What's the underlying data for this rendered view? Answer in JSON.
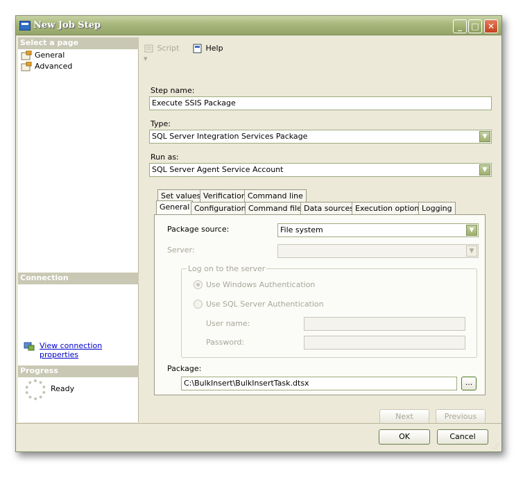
{
  "window": {
    "title": "New Job Step"
  },
  "left": {
    "select_page_header": "Select a page",
    "pages": [
      {
        "label": "General"
      },
      {
        "label": "Advanced"
      }
    ],
    "connection_header": "Connection",
    "view_connection_properties": "View connection properties",
    "progress_header": "Progress",
    "progress_status": "Ready"
  },
  "toolbar": {
    "script_label": "Script",
    "help_label": "Help"
  },
  "form": {
    "step_name_label": "Step name:",
    "step_name_value": "Execute SSIS Package",
    "type_label": "Type:",
    "type_value": "SQL Server Integration Services Package",
    "run_as_label": "Run as:",
    "run_as_value": "SQL Server Agent Service Account"
  },
  "tabs": {
    "row1": [
      "Set values",
      "Verification",
      "Command line"
    ],
    "row2": [
      "General",
      "Configurations",
      "Command files",
      "Data sources",
      "Execution options",
      "Logging"
    ]
  },
  "general_tab": {
    "package_source_label": "Package source:",
    "package_source_value": "File system",
    "server_label": "Server:",
    "server_value": "",
    "logon_group_label": "Log on to the server",
    "windows_auth_label": "Use Windows Authentication",
    "sql_auth_label": "Use SQL Server Authentication",
    "user_name_label": "User name:",
    "password_label": "Password:",
    "package_label": "Package:",
    "package_value": "C:\\BulkInsert\\BulkInsertTask.dtsx",
    "browse_label": "..."
  },
  "nav": {
    "next_label": "Next",
    "previous_label": "Previous"
  },
  "footer": {
    "ok_label": "OK",
    "cancel_label": "Cancel"
  }
}
